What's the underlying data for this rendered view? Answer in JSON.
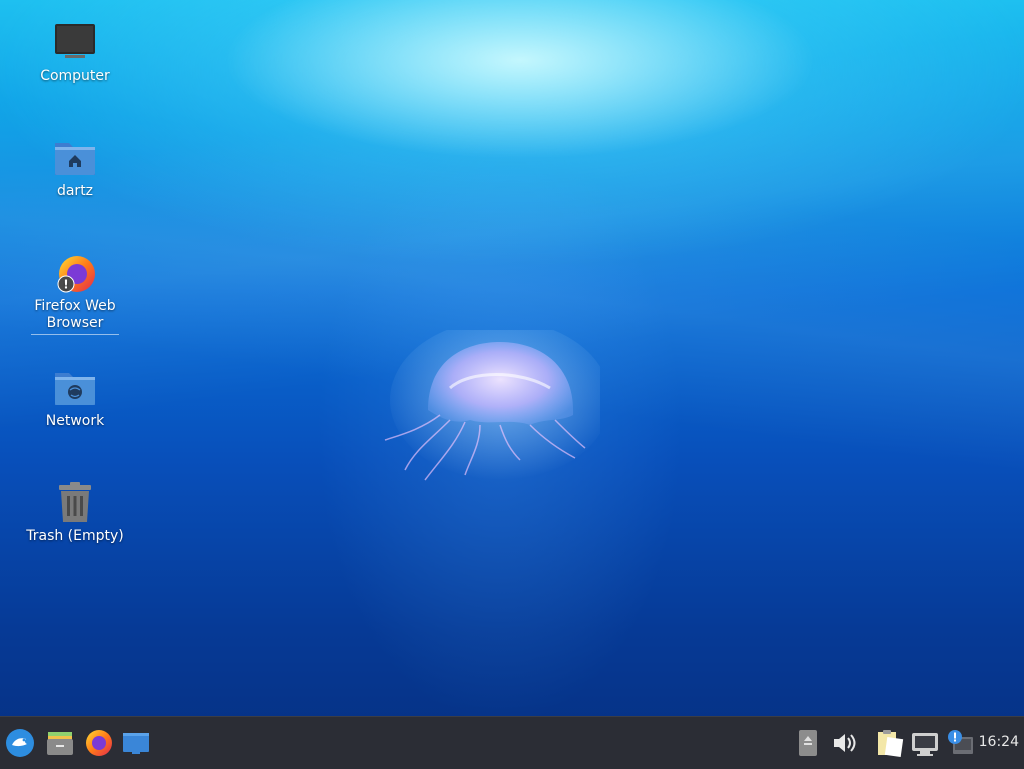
{
  "desktop": {
    "icons": [
      {
        "label": "Computer"
      },
      {
        "label": "dartz"
      },
      {
        "label_line1": "Firefox Web",
        "label_line2": "Browser"
      },
      {
        "label": "Network"
      },
      {
        "label": "Trash (Empty)"
      }
    ]
  },
  "taskbar": {
    "launchers": [
      "whisker-menu-icon",
      "file-manager-icon",
      "firefox-icon",
      "show-desktop-icon"
    ],
    "tray": [
      "removable-drive-icon",
      "volume-icon",
      "clipboard-icon",
      "network-icon",
      "notification-icon"
    ],
    "clock": "16:24"
  },
  "colors": {
    "taskbar_bg": "#2b2d35",
    "folder_blue": "#4a90d9"
  }
}
